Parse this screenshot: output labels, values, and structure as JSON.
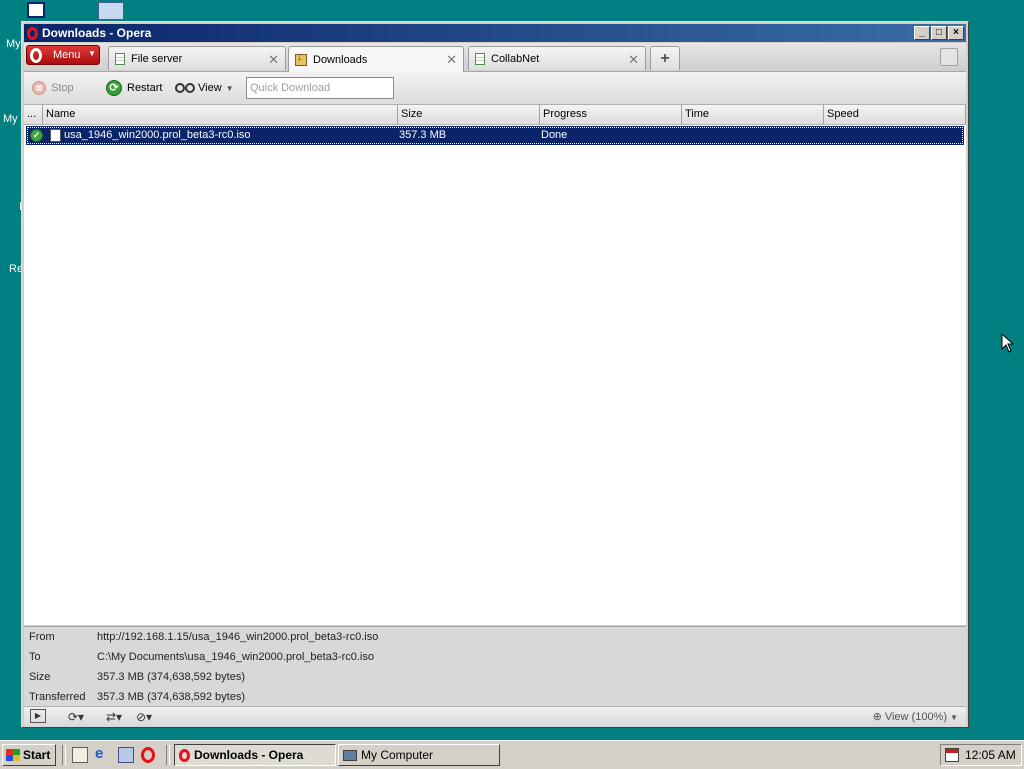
{
  "desktop": {
    "labels": [
      "My",
      "My",
      "I",
      "Re"
    ]
  },
  "window": {
    "title": "Downloads - Opera",
    "menu_label": "Menu"
  },
  "tabs": [
    {
      "label": "File server",
      "icon": "page-icon"
    },
    {
      "label": "Downloads",
      "icon": "download-icon",
      "active": true
    },
    {
      "label": "CollabNet",
      "icon": "page-icon"
    }
  ],
  "toolbar": {
    "stop_label": "Stop",
    "restart_label": "Restart",
    "view_label": "View",
    "quick_placeholder": "Quick Download"
  },
  "list": {
    "columns": [
      "...",
      "Name",
      "Size",
      "Progress",
      "Time",
      "Speed"
    ],
    "rows": [
      {
        "name": "usa_1946_win2000.prol_beta3-rc0.iso",
        "size": "357.3 MB",
        "progress": "Done",
        "time": "",
        "speed": "",
        "status_icon": "check-icon"
      }
    ]
  },
  "details": {
    "from_label": "From",
    "from_value": "http://192.168.1.15/usa_1946_win2000.prol_beta3-rc0.iso",
    "to_label": "To",
    "to_value": "C:\\My Documents\\usa_1946_win2000.prol_beta3-rc0.iso",
    "size_label": "Size",
    "size_value": "357.3 MB (374,638,592 bytes)",
    "transferred_label": "Transferred",
    "transferred_value": "357.3 MB (374,638,592 bytes)"
  },
  "statusbar": {
    "zoom_label": "View (100%)"
  },
  "taskbar": {
    "start_label": "Start",
    "tasks": [
      {
        "label": "Downloads - Opera",
        "active": true
      },
      {
        "label": "My Computer",
        "active": false
      }
    ],
    "clock": "12:05 AM"
  },
  "colors": {
    "desktop": "#008080",
    "title_active": "#0a246a",
    "selection": "#0a246a",
    "opera_red": "#e8101a"
  }
}
